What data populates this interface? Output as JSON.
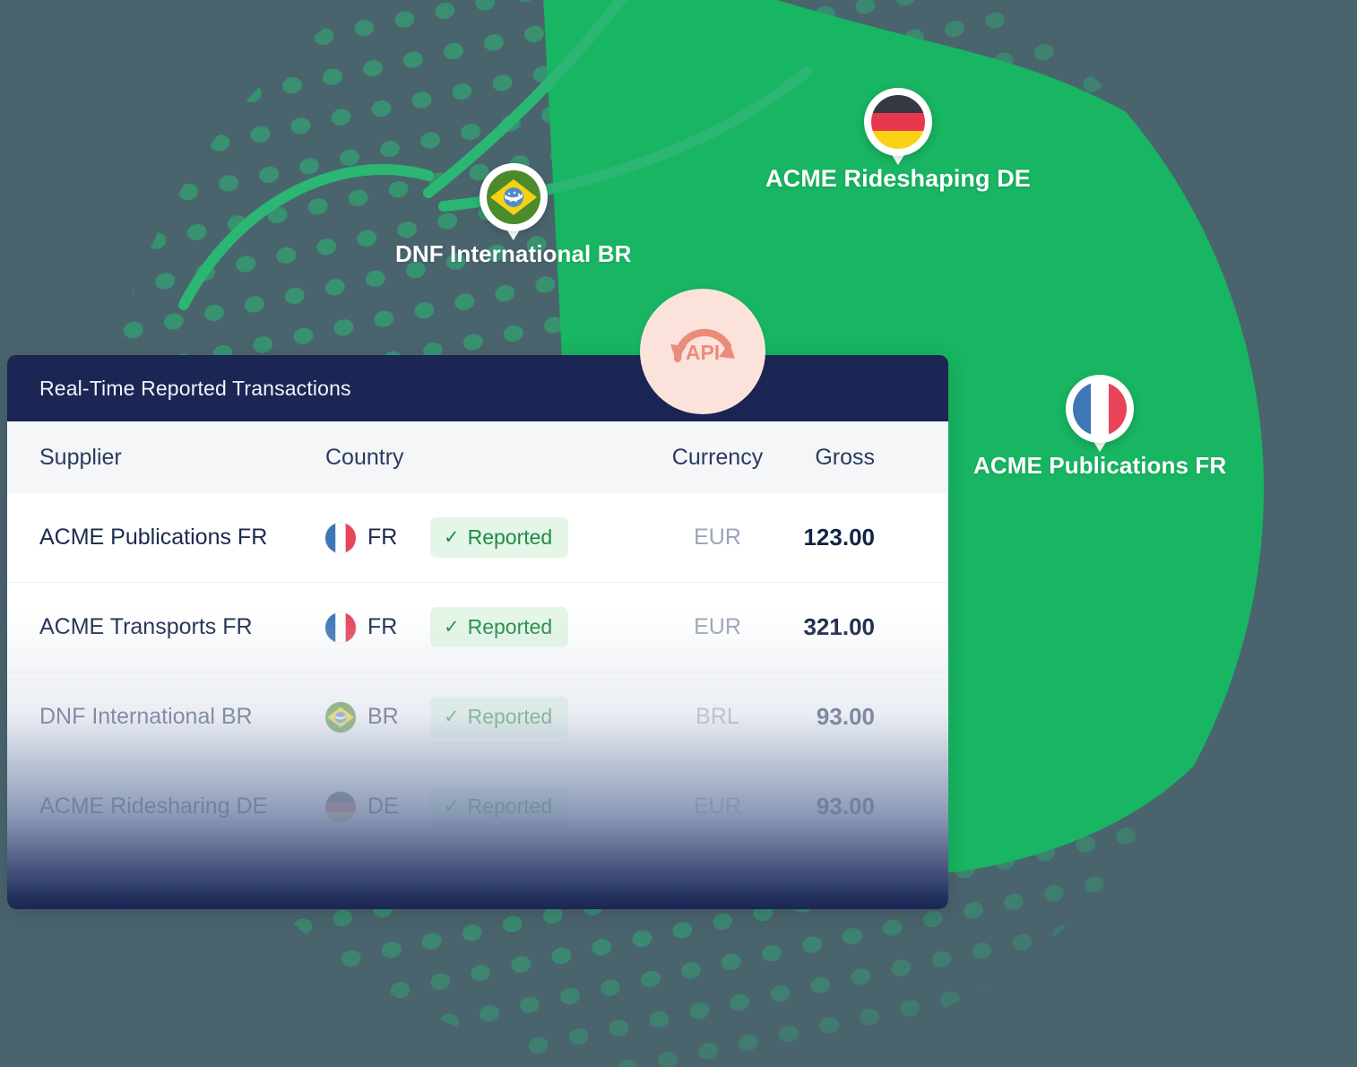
{
  "background": {
    "base_color": "#4a646e",
    "globe_green": "#18b562",
    "dot_green": "#2bb673"
  },
  "map_pins": [
    {
      "id": "de",
      "label": "ACME Rideshaping DE",
      "country_code": "DE",
      "flag": "germany-flag-icon"
    },
    {
      "id": "br",
      "label": "DNF International BR",
      "country_code": "BR",
      "flag": "brazil-flag-icon"
    },
    {
      "id": "fr",
      "label": "ACME Publications FR",
      "country_code": "FR",
      "flag": "france-flag-icon"
    }
  ],
  "api_badge": {
    "label": "API",
    "icon": "api-sync-icon",
    "circle_color": "#fbe3dc",
    "accent_color": "#ea8c7c"
  },
  "card": {
    "title": "Real-Time Reported Transactions",
    "title_bar_color": "#1b2655",
    "columns": [
      "Supplier",
      "Country",
      "Currency",
      "Gross"
    ],
    "rows": [
      {
        "supplier": "ACME Publications FR",
        "country_code": "FR",
        "flag": "france-flag-icon",
        "status": "Reported",
        "status_icon": "check-icon",
        "currency": "EUR",
        "gross": "123.00"
      },
      {
        "supplier": "ACME Transports FR",
        "country_code": "FR",
        "flag": "france-flag-icon",
        "status": "Reported",
        "status_icon": "check-icon",
        "currency": "EUR",
        "gross": "321.00"
      },
      {
        "supplier": "DNF International BR",
        "country_code": "BR",
        "flag": "brazil-flag-icon",
        "status": "Reported",
        "status_icon": "check-icon",
        "currency": "BRL",
        "gross": "93.00"
      },
      {
        "supplier": "ACME Ridesharing DE",
        "country_code": "DE",
        "flag": "germany-flag-icon",
        "status": "Reported",
        "status_icon": "check-icon",
        "currency": "EUR",
        "gross": "93.00"
      }
    ],
    "status_colors": {
      "background": "#e4f6e7",
      "text": "#1f8b46"
    }
  }
}
